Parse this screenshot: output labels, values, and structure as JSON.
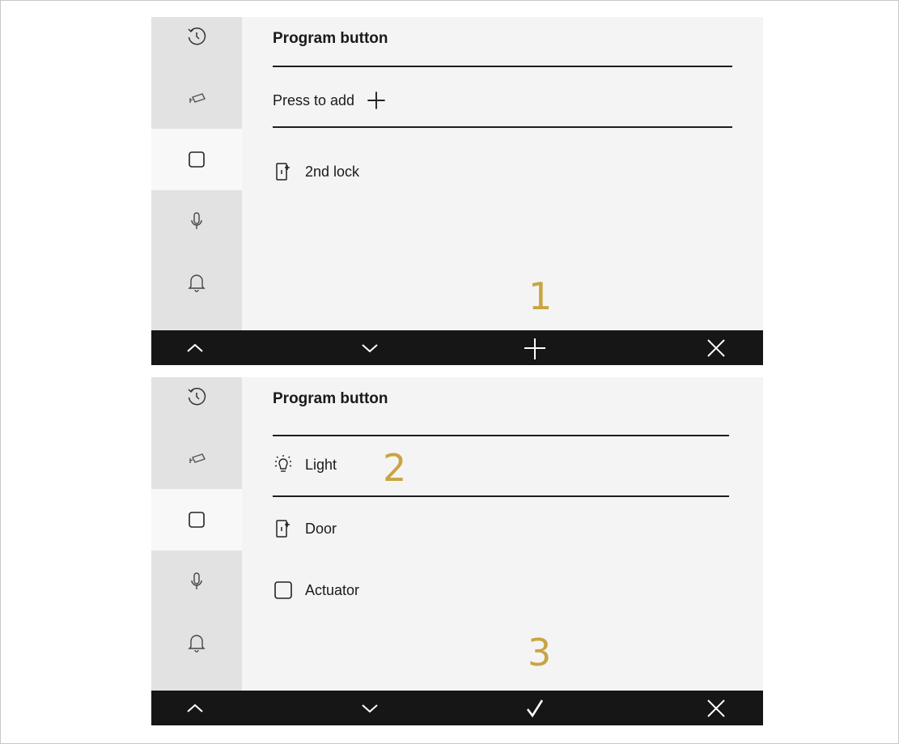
{
  "screen1": {
    "title": "Program button",
    "add_label": "Press to add",
    "items": [
      {
        "icon": "door-lock-icon",
        "label": "2nd lock"
      }
    ],
    "annotation": "1"
  },
  "screen2": {
    "title": "Program button",
    "items": [
      {
        "icon": "light-bulb-icon",
        "label": "Light",
        "selected": true
      },
      {
        "icon": "door-lock-icon",
        "label": "Door"
      },
      {
        "icon": "checkbox-icon",
        "label": "Actuator"
      }
    ],
    "annotation_light": "2",
    "annotation_confirm": "3"
  },
  "sidebar_icons": [
    "history-icon",
    "camera-icon",
    "button-square-icon",
    "microphone-icon",
    "bell-icon"
  ],
  "bottom_bar_screen1": [
    "chevron-up-icon",
    "chevron-down-icon",
    "plus-icon",
    "close-icon"
  ],
  "bottom_bar_screen2": [
    "chevron-up-icon",
    "chevron-down-icon",
    "checkmark-icon",
    "close-icon"
  ],
  "colors": {
    "annotation": "#c9a441",
    "bottom_bar": "#161616",
    "sidebar": "#e2e2e2",
    "active_item": "#f8f8f8"
  }
}
